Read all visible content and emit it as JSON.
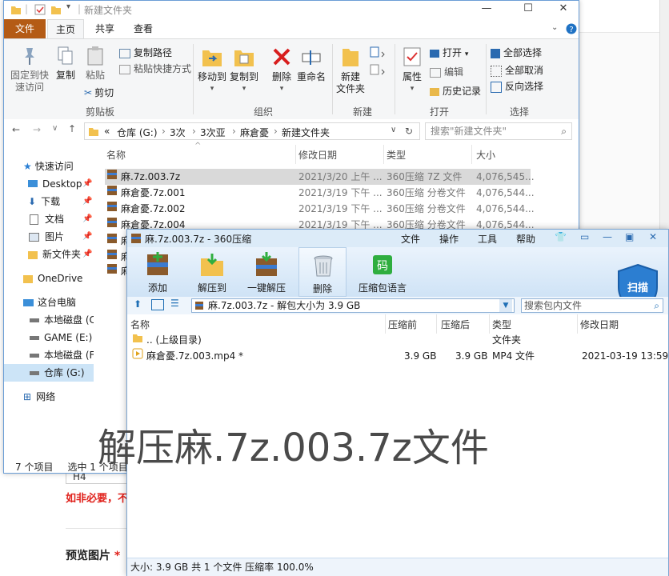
{
  "background_page": {
    "field_value": "H4",
    "warning": "如非必要，不要",
    "preview_label": "预览图片",
    "required_mark": "*"
  },
  "explorer": {
    "title": "新建文件夹",
    "window_controls": {
      "minimize": "—",
      "maximize": "☐",
      "close": "✕"
    },
    "tabs": [
      "文件",
      "主页",
      "共享",
      "查看"
    ],
    "ribbon": {
      "clipboard": {
        "pin": "固定到快\n速访问",
        "copy": "复制",
        "paste": "粘贴",
        "copy_path": "复制路径",
        "paste_shortcut": "粘贴快捷方式",
        "cut": "剪切",
        "label": "剪贴板"
      },
      "organize": {
        "move_to": "移动到",
        "copy_to": "复制到",
        "delete": "删除",
        "rename": "重命名",
        "label": "组织"
      },
      "new": {
        "new_folder": "新建\n文件夹",
        "label": "新建"
      },
      "open": {
        "properties": "属性",
        "open": "打开",
        "edit": "编辑",
        "history": "历史记录",
        "label": "打开"
      },
      "select": {
        "select_all": "全部选择",
        "select_none": "全部取消",
        "invert": "反向选择",
        "label": "选择"
      }
    },
    "address": {
      "crumbs": [
        "«",
        "仓库 (G:)",
        "3次",
        "3次亚",
        "麻倉憂",
        "新建文件夹"
      ],
      "search_placeholder": "搜索\"新建文件夹\""
    },
    "nav": [
      {
        "label": "快速访问",
        "icon": "star-icon"
      },
      {
        "label": "Desktop",
        "icon": "desktop-icon",
        "pinned": true
      },
      {
        "label": "下载",
        "icon": "download-icon",
        "pinned": true
      },
      {
        "label": "文档",
        "icon": "document-icon",
        "pinned": true
      },
      {
        "label": "图片",
        "icon": "picture-icon",
        "pinned": true
      },
      {
        "label": "新文件夹",
        "icon": "folder-icon",
        "pinned": true
      },
      {
        "label": "OneDrive",
        "icon": "folder-icon"
      },
      {
        "label": "这台电脑",
        "icon": "computer-icon"
      },
      {
        "label": "本地磁盘 (C",
        "icon": "drive-icon"
      },
      {
        "label": "GAME (E:)",
        "icon": "drive-icon"
      },
      {
        "label": "本地磁盘 (F:",
        "icon": "drive-icon"
      },
      {
        "label": "仓库 (G:)",
        "icon": "drive-icon",
        "selected": true
      },
      {
        "label": "网络",
        "icon": "network-icon"
      }
    ],
    "columns": [
      "名称",
      "修改日期",
      "类型",
      "大小"
    ],
    "files": [
      {
        "name": "麻.7z.003.7z",
        "date": "2021/3/20 上午 ...",
        "type": "360压缩 7Z 文件",
        "size": "4,076,545...",
        "selected": true
      },
      {
        "name": "麻倉憂.7z.001",
        "date": "2021/3/19 下午 ...",
        "type": "360压缩 分卷文件",
        "size": "4,076,544..."
      },
      {
        "name": "麻倉憂.7z.002",
        "date": "2021/3/19 下午 ...",
        "type": "360压缩 分卷文件",
        "size": "4,076,544..."
      },
      {
        "name": "麻倉憂.7z.004",
        "date": "2021/3/19 下午 ...",
        "type": "360压缩 分卷文件",
        "size": "4,076,544..."
      },
      {
        "name": "麻",
        "date": "",
        "type": "",
        "size": ""
      },
      {
        "name": "麻",
        "date": "",
        "type": "",
        "size": ""
      },
      {
        "name": "麻",
        "date": "",
        "type": "",
        "size": ""
      }
    ],
    "status": {
      "count": "7 个项目",
      "selected": "选中 1 个项目"
    }
  },
  "zip360": {
    "title": "麻.7z.003.7z - 360压缩",
    "menu": [
      "文件",
      "操作",
      "工具",
      "帮助"
    ],
    "toolbar": [
      "添加",
      "解压到",
      "一键解压",
      "删除",
      "压缩包语言"
    ],
    "scan_label": "扫描",
    "address": "麻.7z.003.7z - 解包大小为 3.9 GB",
    "search_placeholder": "搜索包内文件",
    "columns": [
      "名称",
      "压缩前",
      "压缩后",
      "类型",
      "修改日期"
    ],
    "rows": [
      {
        "name": ".. (上级目录)",
        "before": "",
        "after": "",
        "type": "文件夹",
        "date": ""
      },
      {
        "name": "麻倉憂.7z.003.mp4 *",
        "before": "3.9 GB",
        "after": "3.9 GB",
        "type": "MP4 文件",
        "date": "2021-03-19 13:59"
      }
    ],
    "status": "大小: 3.9 GB 共 1 个文件 压缩率 100.0%"
  },
  "overlay_caption": "解压麻.7z.003.7z文件",
  "colors": {
    "explorer_file_tab": "#b45b15",
    "zip_blue": "#1f6fb5",
    "warning_red": "#e0201a"
  }
}
